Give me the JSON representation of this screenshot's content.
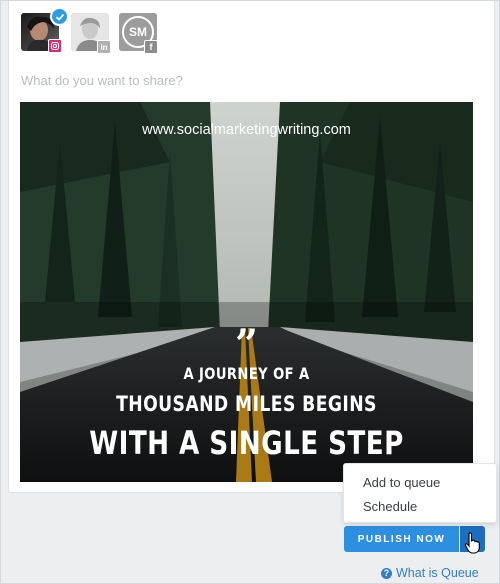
{
  "composer": {
    "prompt_placeholder": "What do you want to share?",
    "profiles": [
      {
        "name": "instagram-profile",
        "network": "instagram",
        "selected": true
      },
      {
        "name": "linkedin-profile",
        "network": "linkedin",
        "selected": false
      },
      {
        "name": "facebook-page",
        "network": "facebook",
        "selected": false,
        "avatar_text": "SM"
      }
    ],
    "network_badges": {
      "linkedin": "in",
      "facebook": "f"
    }
  },
  "image": {
    "url_overlay": "www.socialmarketingwriting.com",
    "quote_mark": "”",
    "quote_lines": [
      "A JOURNEY OF A",
      "THOUSAND MILES BEGINS",
      "WITH A SINGLE STEP"
    ]
  },
  "menu": {
    "items": [
      "Add to queue",
      "Schedule"
    ]
  },
  "actions": {
    "publish_label": "PUBLISH NOW",
    "queue_help_label": "What is Queue",
    "help_glyph": "?"
  },
  "colors": {
    "accent": "#2d8fe0",
    "accent_dark": "#1c6fbf",
    "instagram": "#d62976",
    "check": "#2d9de2",
    "link": "#2f7fc6"
  }
}
